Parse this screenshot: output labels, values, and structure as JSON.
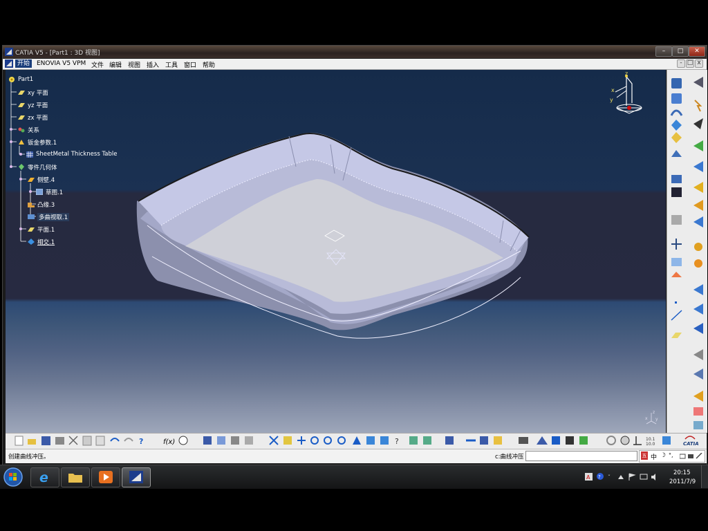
{
  "window": {
    "title": "CATIA V5 - [Part1 : 3D 视图]",
    "controls": [
      "–",
      "□",
      "✕"
    ]
  },
  "menu": [
    "开始",
    "ENOVIA V5 VPM",
    "文件",
    "编辑",
    "视图",
    "插入",
    "工具",
    "窗口",
    "帮助"
  ],
  "tree": {
    "root": "Part1",
    "items": [
      "xy 平面",
      "yz 平面",
      "zx 平面",
      "关系",
      "钣金参数.1",
      "SheetMetal Thickness Table",
      "零件几何体",
      "侧壁.4",
      "草图.1",
      "凸缘.3",
      "多曲视取.1",
      "平面.1",
      "相交.1"
    ]
  },
  "compass": {
    "labels": [
      "z",
      "x",
      "y"
    ]
  },
  "mini_axis": {
    "labels": [
      "z",
      "x",
      "y"
    ]
  },
  "status": {
    "message": "创建曲线冲压。",
    "command_label": "c:曲线冲压",
    "command_value": ""
  },
  "ime": {
    "chars": [
      "中",
      "☽",
      "°,"
    ]
  },
  "catia_logo": "CATIA",
  "taskbar": {
    "time": "20:15",
    "date": "2011/7/9"
  },
  "colors": {
    "accent": "#1a3d7a",
    "part_surface": "#c9cde8",
    "viewport_top": "#152b4a"
  }
}
